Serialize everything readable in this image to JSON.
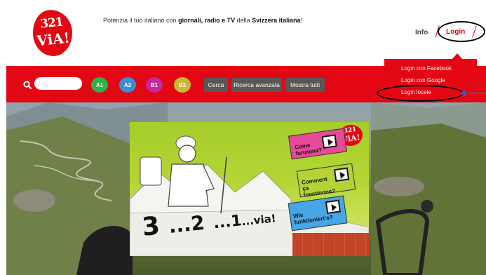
{
  "header": {
    "logo": {
      "numbers": "321",
      "via": "ViA!"
    },
    "tagline": {
      "part1": "Potenzia il tuo italiano con ",
      "bold1": "giornali, radio e TV",
      "part2": " della ",
      "bold2": "Svizzera italiana",
      "part3": "!"
    },
    "nav": {
      "info": "Info",
      "login": "Login"
    }
  },
  "toolbar": {
    "search_icon": "search-icon",
    "search_placeholder": "...",
    "levels": [
      {
        "label": "A1",
        "color": "#2eb34a"
      },
      {
        "label": "A2",
        "color": "#3a8fd1"
      },
      {
        "label": "B1",
        "color": "#c2299a"
      },
      {
        "label": "B2",
        "color": "#c9b934"
      }
    ],
    "buttons": {
      "search": "Cerca",
      "advanced": "Ricerca avanzata",
      "show_all": "Mostra tutti"
    }
  },
  "login_menu": {
    "items": [
      "Login con Facebook",
      "Login con Google",
      "Login locale"
    ]
  },
  "banner": {
    "title_3": "3",
    "title_2": "...2",
    "title_1": "...1",
    "title_via": "...via!",
    "logo_numbers": "321",
    "logo_via": "ViA!",
    "clapboards": [
      {
        "label": "Come funziona?",
        "color": "#e84a9a"
      },
      {
        "label": "Comment ça fonctionne?",
        "color": "#b5d334"
      },
      {
        "label": "Wie funktioniert's?",
        "color": "#47a6e6"
      }
    ]
  },
  "colors": {
    "brand": "#e30613",
    "button": "#575757"
  }
}
